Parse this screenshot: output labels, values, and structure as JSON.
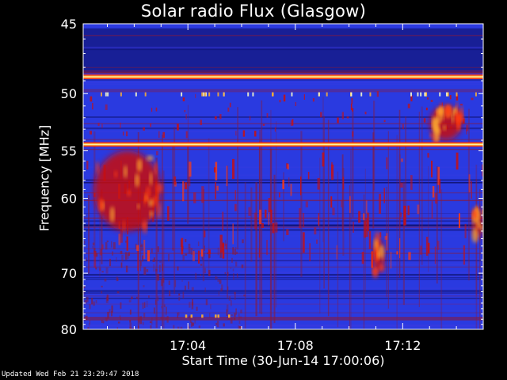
{
  "chart_data": {
    "type": "heatmap",
    "title": "Solar radio Flux (Glasgow)",
    "xlabel": "Start Time (30-Jun-14 17:00:06)",
    "ylabel": "Frequency [MHz]",
    "x_unit": "time (HH:MM)",
    "xlim": [
      "17:00:06",
      "17:15:00"
    ],
    "x_ticks": [
      "17:04",
      "17:08",
      "17:12"
    ],
    "x_tick_values_min": [
      4,
      8,
      12
    ],
    "ylim": [
      45,
      80
    ],
    "y_inverted": true,
    "y_ticks": [
      45,
      50,
      55,
      60,
      70,
      80
    ],
    "colormap": [
      "#0a0a5a",
      "#1a2ed8",
      "#3a3ae0",
      "#8a1a3a",
      "#c81010",
      "#ff3a10",
      "#ffb030",
      "#ffffc8"
    ],
    "background_color": "#2a3ae0",
    "interference_bands_mhz": [
      48.7,
      54.4
    ],
    "bright_regions": [
      {
        "t_min": [
          0.5,
          3.0
        ],
        "f_mhz": [
          55,
          64
        ],
        "level": "high"
      },
      {
        "t_min": [
          13.0,
          14.2
        ],
        "f_mhz": [
          51,
          54
        ],
        "level": "high"
      },
      {
        "t_min": [
          10.9,
          11.3
        ],
        "f_mhz": [
          65,
          70
        ],
        "level": "medium"
      },
      {
        "t_min": [
          14.6,
          15.0
        ],
        "f_mhz": [
          61,
          65
        ],
        "level": "medium"
      }
    ],
    "grid": false,
    "legend": "none"
  },
  "footer": "Updated Wed Feb 21 23:29:47 2018"
}
